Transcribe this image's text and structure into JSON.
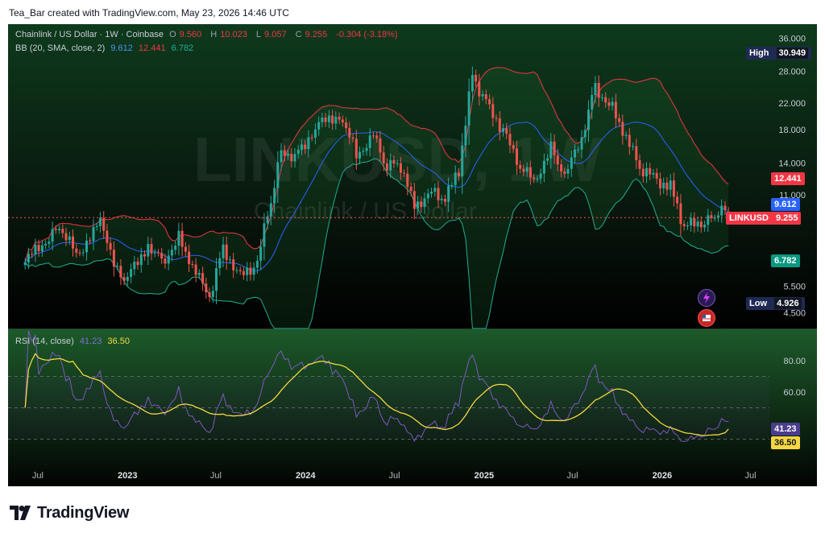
{
  "credit": "Tea_Bar created with TradingView.com, May 23, 2026 14:46 UTC",
  "legend": {
    "symbol": "Chainlink / US Dollar · 1W · Coinbase",
    "o_label": "O",
    "o_value": "9.560",
    "h_label": "H",
    "h_value": "10.023",
    "l_label": "L",
    "l_value": "9.057",
    "c_label": "C",
    "c_value": "9.255",
    "change": "-0.304 (-3.18%)",
    "bb_label": "BB (20, SMA, close, 2)",
    "bb_basis": "9.612",
    "bb_upper": "12.441",
    "bb_lower": "6.782",
    "rsi_label": "RSI (14, close)",
    "rsi_value": "41.23",
    "rsi_ma": "36.50"
  },
  "watermark": {
    "ticker": "LINKUSD, 1W",
    "name": "Chainlink / US Dollar"
  },
  "labels": {
    "high_tag": "High",
    "high_value": "30.949",
    "low_tag": "Low",
    "low_value": "4.926",
    "upper_value": "12.441",
    "basis_value": "9.612",
    "symbol_tag": "LINKUSD",
    "price_value": "9.255",
    "lower_value": "6.782",
    "rsi_value": "41.23",
    "rsi_ma_value": "36.50"
  },
  "colors": {
    "up": "#26a69a",
    "down": "#ef5350",
    "upper_band": "#f23645",
    "basis": "#2962ff",
    "lower_band": "#22ab94",
    "rsi": "#7e57c2",
    "rsi_ma": "#f5d742"
  },
  "chart_data": {
    "type": "candlestick",
    "symbol": "LINKUSD",
    "interval": "1W",
    "scale": "log",
    "price_axis_ticks": [
      "36.000",
      "28.000",
      "22.000",
      "18.000",
      "14.000",
      "11.000",
      "5.500",
      "4.500"
    ],
    "rsi_axis_ticks": [
      "80.00",
      "60.00"
    ],
    "rsi_levels": [
      70,
      50,
      30
    ],
    "time_axis_ticks": [
      "Jul",
      "2023",
      "Jul",
      "2024",
      "Jul",
      "2025",
      "Jul",
      "2026",
      "Jul"
    ],
    "last": {
      "open": 9.56,
      "high": 10.023,
      "low": 9.057,
      "close": 9.255
    },
    "high": 30.949,
    "low": 4.926,
    "bb_last": {
      "basis": 9.612,
      "upper": 12.441,
      "lower": 6.782
    },
    "rsi_last": 41.23,
    "rsi_ma_last": 36.5,
    "close_waypoints": [
      {
        "date": "2022-06-05",
        "close": 6.6
      },
      {
        "date": "2022-08-14",
        "close": 8.7
      },
      {
        "date": "2022-09-18",
        "close": 7.0
      },
      {
        "date": "2022-11-06",
        "close": 8.8
      },
      {
        "date": "2022-12-25",
        "close": 5.6
      },
      {
        "date": "2023-02-12",
        "close": 7.6
      },
      {
        "date": "2023-03-12",
        "close": 6.6
      },
      {
        "date": "2023-04-16",
        "close": 7.9
      },
      {
        "date": "2023-05-14",
        "close": 6.3
      },
      {
        "date": "2023-06-18",
        "close": 5.1
      },
      {
        "date": "2023-07-16",
        "close": 7.4
      },
      {
        "date": "2023-08-20",
        "close": 5.9
      },
      {
        "date": "2023-09-24",
        "close": 6.6
      },
      {
        "date": "2023-10-22",
        "close": 10.6
      },
      {
        "date": "2023-11-12",
        "close": 15.5
      },
      {
        "date": "2023-12-10",
        "close": 14.7
      },
      {
        "date": "2024-01-21",
        "close": 18.3
      },
      {
        "date": "2024-03-10",
        "close": 20.5
      },
      {
        "date": "2024-04-14",
        "close": 14.9
      },
      {
        "date": "2024-05-19",
        "close": 17.2
      },
      {
        "date": "2024-06-16",
        "close": 13.6
      },
      {
        "date": "2024-07-14",
        "close": 13.8
      },
      {
        "date": "2024-08-11",
        "close": 10.2
      },
      {
        "date": "2024-09-15",
        "close": 11.2
      },
      {
        "date": "2024-10-13",
        "close": 10.6
      },
      {
        "date": "2024-11-10",
        "close": 13.2
      },
      {
        "date": "2024-12-08",
        "close": 27.5
      },
      {
        "date": "2025-01-05",
        "close": 22.0
      },
      {
        "date": "2025-02-09",
        "close": 18.0
      },
      {
        "date": "2025-03-09",
        "close": 14.0
      },
      {
        "date": "2025-04-13",
        "close": 12.2
      },
      {
        "date": "2025-05-18",
        "close": 15.6
      },
      {
        "date": "2025-06-15",
        "close": 12.5
      },
      {
        "date": "2025-07-20",
        "close": 17.0
      },
      {
        "date": "2025-08-17",
        "close": 25.0
      },
      {
        "date": "2025-09-21",
        "close": 21.0
      },
      {
        "date": "2025-10-19",
        "close": 16.8
      },
      {
        "date": "2025-11-16",
        "close": 13.5
      },
      {
        "date": "2025-12-21",
        "close": 12.3
      },
      {
        "date": "2026-01-18",
        "close": 11.8
      },
      {
        "date": "2026-02-15",
        "close": 8.6
      },
      {
        "date": "2026-03-22",
        "close": 8.9
      },
      {
        "date": "2026-04-19",
        "close": 9.4
      },
      {
        "date": "2026-05-03",
        "close": 10.0
      },
      {
        "date": "2026-05-17",
        "close": 9.255
      }
    ]
  }
}
